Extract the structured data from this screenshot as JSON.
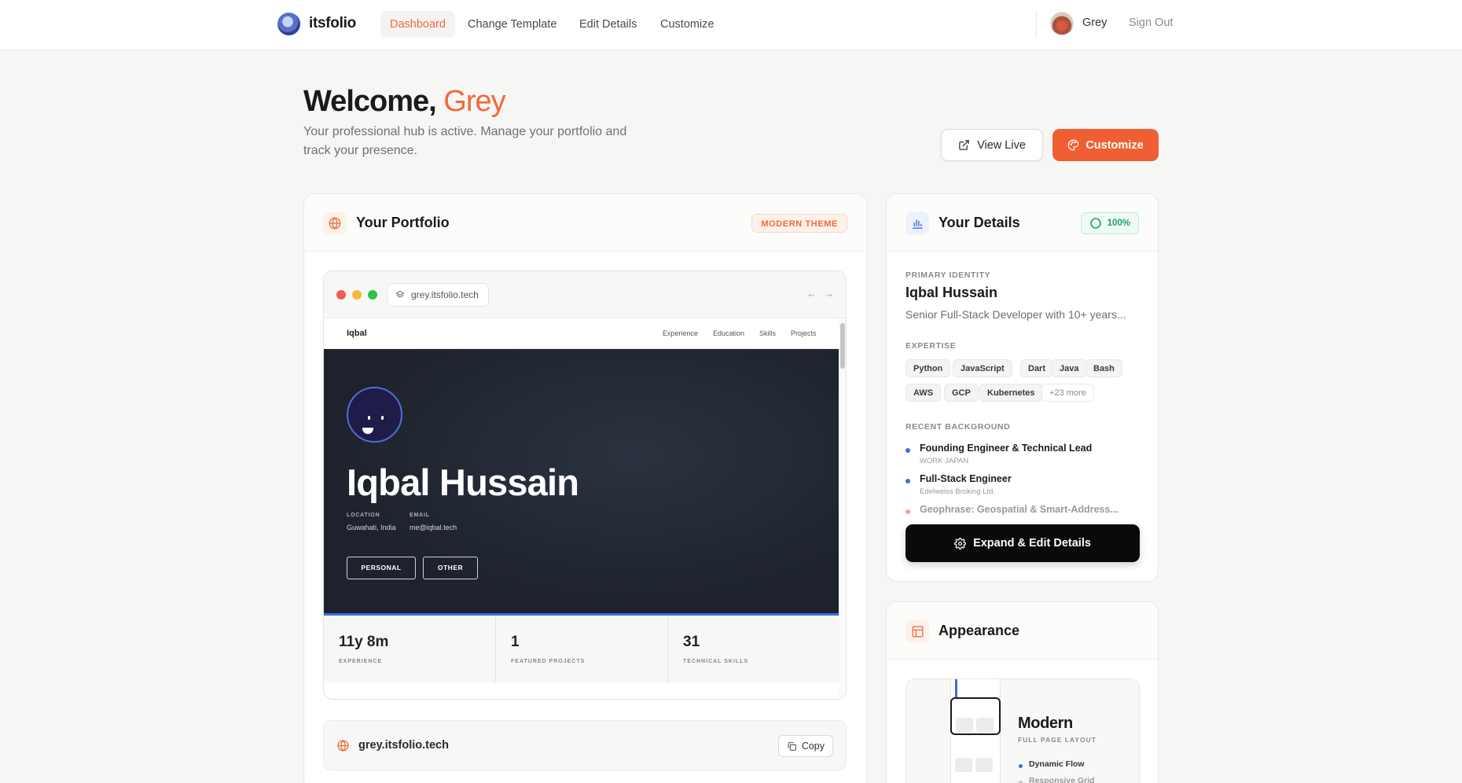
{
  "nav": {
    "brand": "itsfolio",
    "links": [
      "Dashboard",
      "Change Template",
      "Edit Details",
      "Customize"
    ],
    "user": "Grey",
    "signout": "Sign Out"
  },
  "header": {
    "welcome": "Welcome,",
    "name": "Grey",
    "subtitle": "Your professional hub is active. Manage your portfolio and track your presence.",
    "view_live": "View Live",
    "customize": "Customize"
  },
  "portfolio": {
    "title": "Your Portfolio",
    "badge": "MODERN THEME",
    "url": "grey.itsfolio.tech",
    "site": {
      "brand": "Iqbal",
      "links": [
        "Experience",
        "Education",
        "Skills",
        "Projects"
      ],
      "name": "Iqbal Hussain",
      "location_label": "LOCATION",
      "location": "Guwahati, India",
      "email_label": "EMAIL",
      "email": "me@iqbal.tech",
      "buttons": [
        "PERSONAL",
        "OTHER"
      ],
      "stats": [
        {
          "value": "11y 8m",
          "label": "EXPERIENCE"
        },
        {
          "value": "1",
          "label": "FEATURED PROJECTS"
        },
        {
          "value": "31",
          "label": "TECHNICAL SKILLS"
        }
      ]
    },
    "copy_label": "Copy"
  },
  "details": {
    "title": "Your Details",
    "completion": "100%",
    "identity_label": "PRIMARY IDENTITY",
    "name": "Iqbal Hussain",
    "summary": "Senior Full-Stack Developer with 10+ years...",
    "expertise_label": "EXPERTISE",
    "skills": [
      "Python",
      "JavaScript",
      "Dart",
      "Java",
      "Bash",
      "AWS",
      "GCP",
      "Kubernetes",
      "+23 more"
    ],
    "background_label": "RECENT BACKGROUND",
    "jobs": [
      {
        "title": "Founding Engineer & Technical Lead",
        "company": "WORK JAPAN"
      },
      {
        "title": "Full-Stack Engineer",
        "company": "Edelweiss Broking Ltd."
      },
      {
        "title": "Geophrase: Geospatial & Smart-Address...",
        "company": ""
      }
    ],
    "expand_btn": "Expand & Edit Details"
  },
  "appearance": {
    "title": "Appearance",
    "template_name": "Modern",
    "template_sub": "FULL PAGE LAYOUT",
    "features": [
      "Dynamic Flow",
      "Responsive Grid"
    ]
  },
  "colors": {
    "accent": "#ef6a3a",
    "success": "#22a06b",
    "link_blue": "#3b6ee6"
  }
}
